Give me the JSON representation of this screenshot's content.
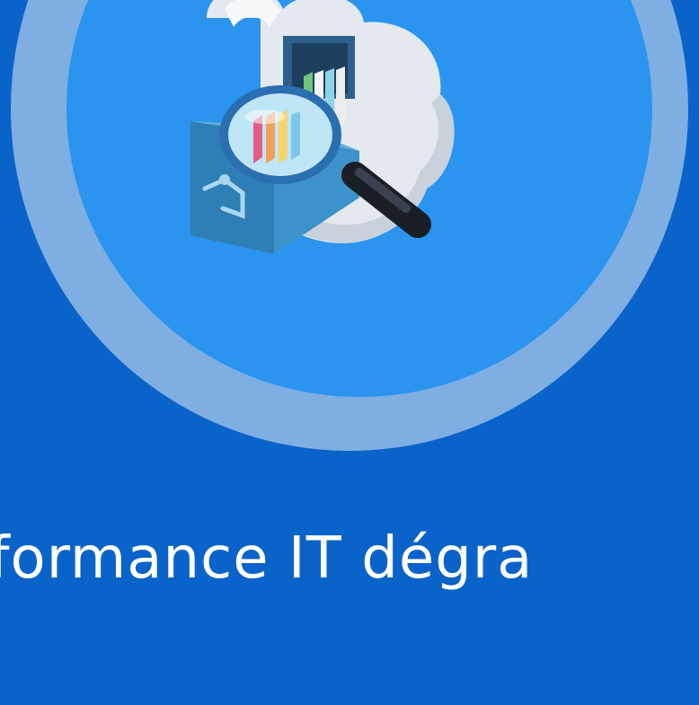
{
  "hero": {
    "title": "formance IT dégra",
    "illustration_icon": "cloud-file-drawer-magnifier-icon"
  },
  "colors": {
    "background": "#0A63C9",
    "ring": "#7FAEE3",
    "circle": "#2A94EF",
    "text": "#FFFFFF"
  }
}
